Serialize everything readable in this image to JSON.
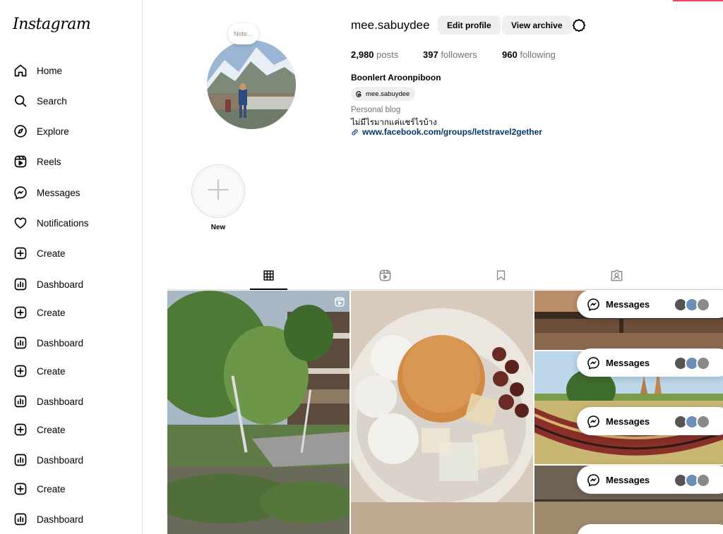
{
  "brand": {
    "logo_text": "Instagram"
  },
  "sidebar": {
    "items": [
      {
        "label": "Home",
        "icon": "home-icon"
      },
      {
        "label": "Search",
        "icon": "search-icon"
      },
      {
        "label": "Explore",
        "icon": "compass-icon"
      },
      {
        "label": "Reels",
        "icon": "reels-icon"
      },
      {
        "label": "Messages",
        "icon": "messenger-icon"
      },
      {
        "label": "Notifications",
        "icon": "heart-icon"
      },
      {
        "label": "Create",
        "icon": "plus-square-icon"
      },
      {
        "label": "Dashboard",
        "icon": "chart-icon"
      },
      {
        "label": "Create",
        "icon": "plus-square-icon"
      },
      {
        "label": "Dashboard",
        "icon": "chart-icon"
      },
      {
        "label": "Create",
        "icon": "plus-square-icon"
      },
      {
        "label": "Dashboard",
        "icon": "chart-icon"
      },
      {
        "label": "Create",
        "icon": "plus-square-icon"
      },
      {
        "label": "Dashboard",
        "icon": "chart-icon"
      },
      {
        "label": "Create",
        "icon": "plus-square-icon"
      },
      {
        "label": "Dashboard",
        "icon": "chart-icon"
      }
    ]
  },
  "profile": {
    "note": "Note...",
    "username": "mee.sabuydee",
    "edit_profile": "Edit profile",
    "view_archive": "View archive",
    "posts_count": "2,980",
    "posts_label": "posts",
    "followers_count": "397",
    "followers_label": "followers",
    "following_count": "960",
    "following_label": "following",
    "full_name": "Boonlert Aroonpiboon",
    "threads_handle": "mee.sabuydee",
    "category": "Personal blog",
    "bio": "ไม่มีไรมากแค่แชร์ไรบ้าง",
    "link": "www.facebook.com/groups/letstravel2gether"
  },
  "highlights": {
    "new_label": "New"
  },
  "messages_pills": [
    {
      "label": "Messages"
    },
    {
      "label": "Messages"
    },
    {
      "label": "Messages"
    },
    {
      "label": "Messages"
    }
  ],
  "colors": {
    "link": "#00376b",
    "border": "#dbdbdb",
    "button_bg": "#efefef",
    "muted": "#737373"
  }
}
